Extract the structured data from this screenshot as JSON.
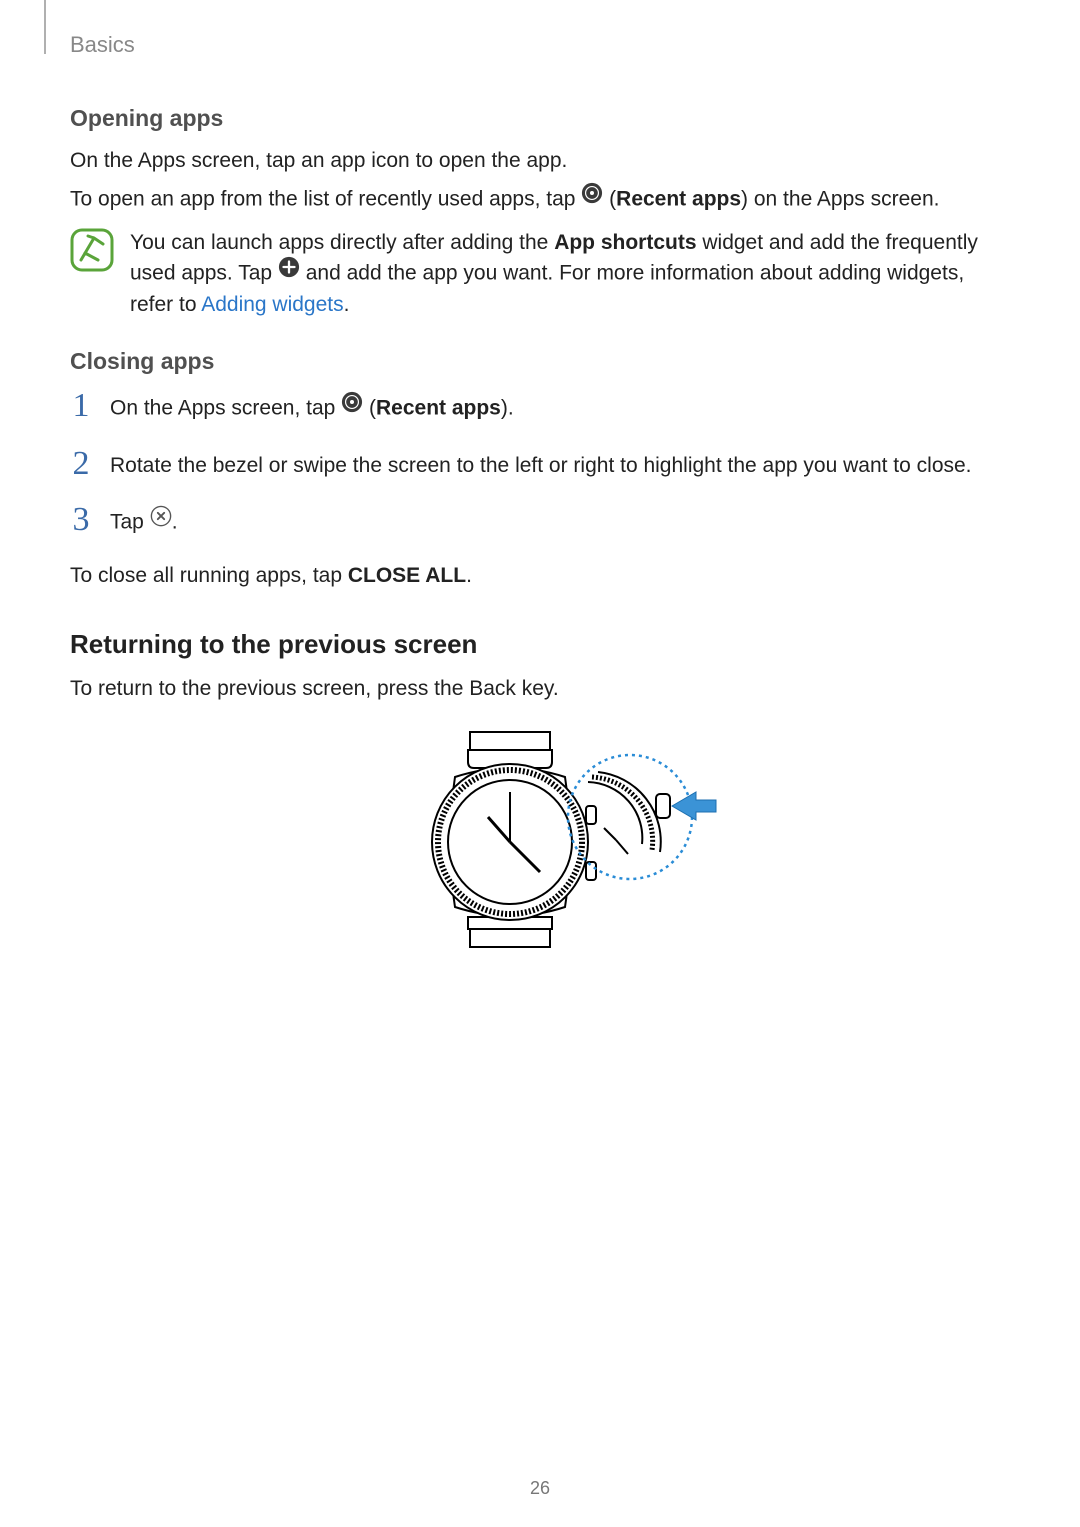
{
  "header": {
    "section": "Basics"
  },
  "opening": {
    "heading": "Opening apps",
    "p1": "On the Apps screen, tap an app icon to open the app.",
    "p2_a": "To open an app from the list of recently used apps, tap ",
    "p2_b": " (",
    "p2_bold": "Recent apps",
    "p2_c": ") on the Apps screen."
  },
  "note": {
    "a": "You can launch apps directly after adding the ",
    "bold1": "App shortcuts",
    "b": " widget and add the frequently used apps. Tap ",
    "c": " and add the app you want. For more information about adding widgets, refer to ",
    "link": "Adding widgets",
    "d": "."
  },
  "closing": {
    "heading": "Closing apps",
    "steps": {
      "s1_a": "On the Apps screen, tap ",
      "s1_b": " (",
      "s1_bold": "Recent apps",
      "s1_c": ").",
      "s2": "Rotate the bezel or swipe the screen to the left or right to highlight the app you want to close.",
      "s3_a": "Tap ",
      "s3_b": "."
    },
    "tail_a": "To close all running apps, tap ",
    "tail_bold": "CLOSE ALL",
    "tail_b": "."
  },
  "returning": {
    "heading": "Returning to the previous screen",
    "p1": "To return to the previous screen, press the Back key."
  },
  "page_number": "26"
}
